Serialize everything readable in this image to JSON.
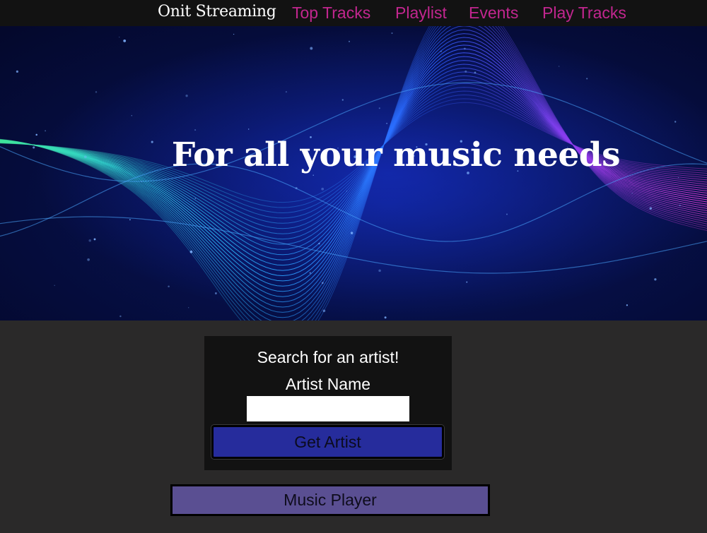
{
  "navbar": {
    "brand": "Onit Streaming",
    "links": [
      "Top Tracks",
      "Playlist",
      "Events",
      "Play Tracks"
    ],
    "link_color": "#c2268f"
  },
  "hero": {
    "title": "For all your music needs"
  },
  "search": {
    "heading": "Search for an artist!",
    "label": "Artist Name",
    "input_value": "",
    "button_label": "Get Artist",
    "button_color": "#262c9c"
  },
  "music_player": {
    "button_label": "Music Player",
    "button_color": "#5a4f92"
  },
  "colors": {
    "page_background": "#2a2929",
    "panel_background": "#121212",
    "hero_background": "#04082b"
  }
}
